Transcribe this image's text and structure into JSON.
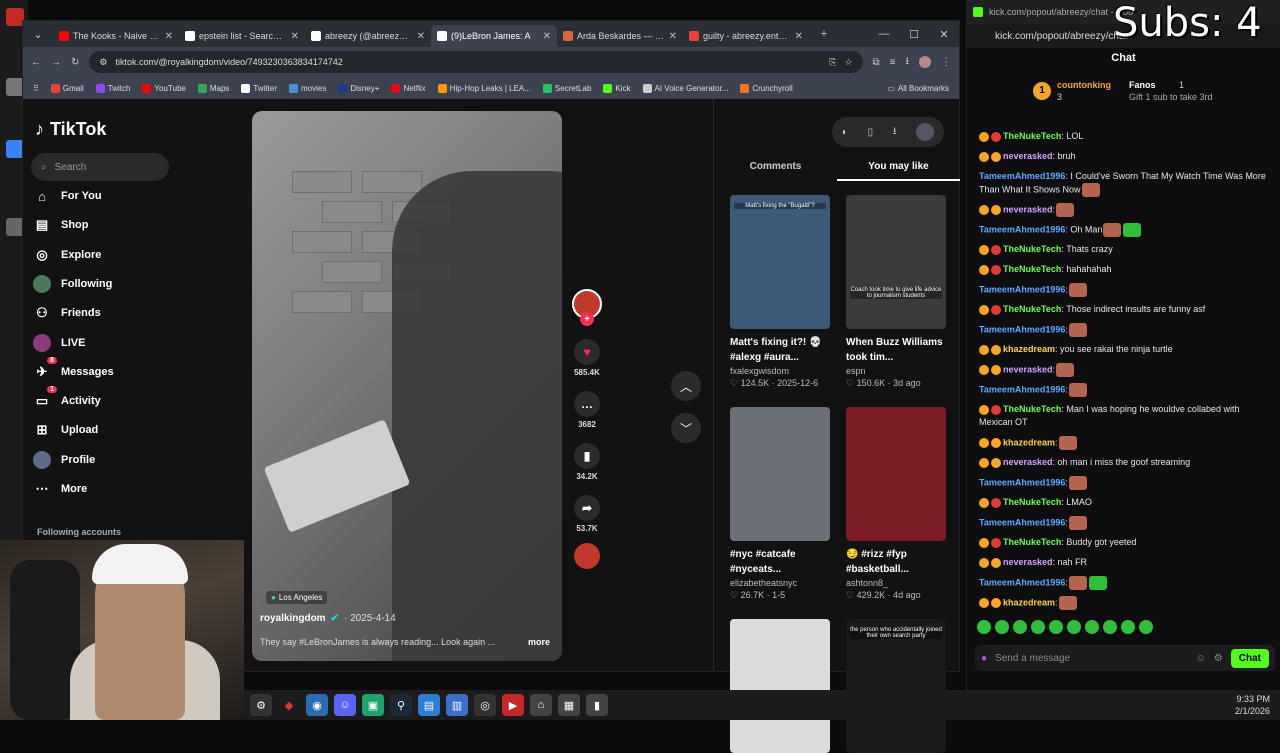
{
  "overlay": {
    "subs": "Subs: 4"
  },
  "browser": {
    "tabs": [
      {
        "title": "The Kooks - Naive - Yo",
        "color": "#ff0000",
        "active": false
      },
      {
        "title": "epstein list - Search / X",
        "color": "#ffffff",
        "active": false
      },
      {
        "title": "abreezy (@abreezy) | T",
        "color": "#ffffff",
        "active": false
      },
      {
        "title": "(9)LeBron James: A",
        "color": "#ffffff",
        "active": true
      },
      {
        "title": "Arda Beskardes — JM",
        "color": "#d46a3a",
        "active": false
      },
      {
        "title": "guilty - abreezy.ent@g",
        "color": "#ea4335",
        "active": false
      }
    ],
    "url": "tiktok.com/@royalkingdom/video/7493230363834174742",
    "bookmarks": [
      {
        "label": "Gmail",
        "color": "#ea4335"
      },
      {
        "label": "Twitch",
        "color": "#9146ff"
      },
      {
        "label": "YouTube",
        "color": "#ff0000"
      },
      {
        "label": "Maps",
        "color": "#34a853"
      },
      {
        "label": "Twitter",
        "color": "#ffffff"
      },
      {
        "label": "movies",
        "color": "#4a90d9"
      },
      {
        "label": "Disney+",
        "color": "#1e3a8a"
      },
      {
        "label": "Netflix",
        "color": "#e50914"
      },
      {
        "label": "Hip-Hop Leaks | LEA...",
        "color": "#ff9900"
      },
      {
        "label": "SecretLab",
        "color": "#22c55e"
      },
      {
        "label": "Kick",
        "color": "#53fc18"
      },
      {
        "label": "AI Voice Generator...",
        "color": "#cccccc"
      },
      {
        "label": "Crunchyroll",
        "color": "#f47521"
      }
    ],
    "all_bookmarks": "All Bookmarks"
  },
  "tiktok": {
    "logo": "TikTok",
    "search_placeholder": "Search",
    "nav": [
      {
        "label": "For You",
        "icon": "home-icon"
      },
      {
        "label": "Shop",
        "icon": "shop-icon"
      },
      {
        "label": "Explore",
        "icon": "compass-icon"
      },
      {
        "label": "Following",
        "icon": "avatar-icon"
      },
      {
        "label": "Friends",
        "icon": "friends-icon"
      },
      {
        "label": "LIVE",
        "icon": "live-icon"
      },
      {
        "label": "Messages",
        "icon": "messages-icon",
        "badge": "8"
      },
      {
        "label": "Activity",
        "icon": "activity-icon",
        "badge": "1"
      },
      {
        "label": "Upload",
        "icon": "upload-icon"
      },
      {
        "label": "Profile",
        "icon": "profile-icon"
      },
      {
        "label": "More",
        "icon": "more-icon"
      }
    ],
    "following_accounts": "Following accounts",
    "video": {
      "location": "Los Angeles",
      "author": "royalkingdom",
      "date": "· 2025-4-14",
      "caption": "They say #LeBronJames is always reading... Look again ...",
      "more": "more"
    },
    "actions": {
      "likes": "585.4K",
      "comments": "3682",
      "saves": "34.2K",
      "shares": "53.7K"
    },
    "right_tabs": {
      "comments": "Comments",
      "you_may_like": "You may like"
    },
    "cards": [
      {
        "title": "Matt's fixing it?! 💀 #alexg #aura...",
        "author": "fxalexgwisdom",
        "meta": "♡ 124.5K · 2025-12-6",
        "thumb_color": "#3d5a78",
        "thumb_text": "Matt's fixing the \"Bugatti\"?"
      },
      {
        "title": "When Buzz Williams took tim...",
        "author": "espn",
        "meta": "♡ 150.6K · 3d ago",
        "thumb_color": "#3b3b3b",
        "thumb_text": "Coach took time to give life advice to journalism students"
      },
      {
        "title": "#nyc #catcafe #nyceats...",
        "author": "elizabetheatsnyc",
        "meta": "♡ 26.7K · 1-5",
        "thumb_color": "#6a6f78",
        "thumb_text": ""
      },
      {
        "title": "😏 #rizz #fyp #basketball...",
        "author": "ashtonn8_",
        "meta": "♡ 429.2K · 4d ago",
        "thumb_color": "#7a1e24",
        "thumb_text": ""
      },
      {
        "title": "",
        "author": "",
        "meta": "",
        "thumb_color": "#dcdcdc",
        "thumb_text": ""
      },
      {
        "title": "",
        "author": "",
        "meta": "",
        "thumb_color": "#1a1a1a",
        "thumb_text": "the person who accidentally joined their own search party"
      }
    ]
  },
  "chat": {
    "window_title": "kick.com/popout/abreezy/chat - Goo",
    "url": "kick.com/popout/abreezy/chat",
    "header": "Chat",
    "pinned": {
      "user1": "countonking",
      "user1_count": "3",
      "user2": "Fanos",
      "user2_count": "1",
      "gift_text": "Gift 1 sub to take 3rd"
    },
    "messages": [
      {
        "user": "TheNukeTech",
        "color": "#6dfb57",
        "text": ": LOL"
      },
      {
        "user": "neverasked",
        "color": "#d6a1ff",
        "text": ": bruh"
      },
      {
        "user": "TameemAhmed1996",
        "color": "#5fa8ff",
        "text": ": I Could've Sworn That My Watch Time Was More Than What It Shows Now"
      },
      {
        "user": "neverasked",
        "color": "#d6a1ff",
        "text": ":"
      },
      {
        "user": "TameemAhmed1996",
        "color": "#5fa8ff",
        "text": ": Oh Man"
      },
      {
        "user": "TheNukeTech",
        "color": "#6dfb57",
        "text": ": Thats crazy"
      },
      {
        "user": "TheNukeTech",
        "color": "#6dfb57",
        "text": ": hahahahah"
      },
      {
        "user": "TameemAhmed1996",
        "color": "#5fa8ff",
        "text": ":"
      },
      {
        "user": "TheNukeTech",
        "color": "#6dfb57",
        "text": ": Those indirect insults are funny asf"
      },
      {
        "user": "TameemAhmed1996",
        "color": "#5fa8ff",
        "text": ":"
      },
      {
        "user": "khazedream",
        "color": "#ffd54a",
        "text": ": you see rakai the ninja turtle"
      },
      {
        "user": "neverasked",
        "color": "#d6a1ff",
        "text": ":"
      },
      {
        "user": "TameemAhmed1996",
        "color": "#5fa8ff",
        "text": ":"
      },
      {
        "user": "TheNukeTech",
        "color": "#6dfb57",
        "text": ": Man I was hoping he wouldve collabed with Mexican OT"
      },
      {
        "user": "khazedream",
        "color": "#ffd54a",
        "text": ":"
      },
      {
        "user": "neverasked",
        "color": "#d6a1ff",
        "text": ": oh man i miss the goof streaming"
      },
      {
        "user": "TameemAhmed1996",
        "color": "#5fa8ff",
        "text": ":"
      },
      {
        "user": "TheNukeTech",
        "color": "#6dfb57",
        "text": ": LMAO"
      },
      {
        "user": "TameemAhmed1996",
        "color": "#5fa8ff",
        "text": ":"
      },
      {
        "user": "TheNukeTech",
        "color": "#6dfb57",
        "text": ": Buddy got yeeted"
      },
      {
        "user": "neverasked",
        "color": "#d6a1ff",
        "text": ": nah FR"
      },
      {
        "user": "TameemAhmed1996",
        "color": "#5fa8ff",
        "text": ":"
      },
      {
        "user": "khazedream",
        "color": "#ffd54a",
        "text": ":"
      }
    ],
    "input_placeholder": "Send a message",
    "send_label": "Chat"
  },
  "taskbar": {
    "time": "9:33 PM",
    "date": "2/1/2026"
  }
}
